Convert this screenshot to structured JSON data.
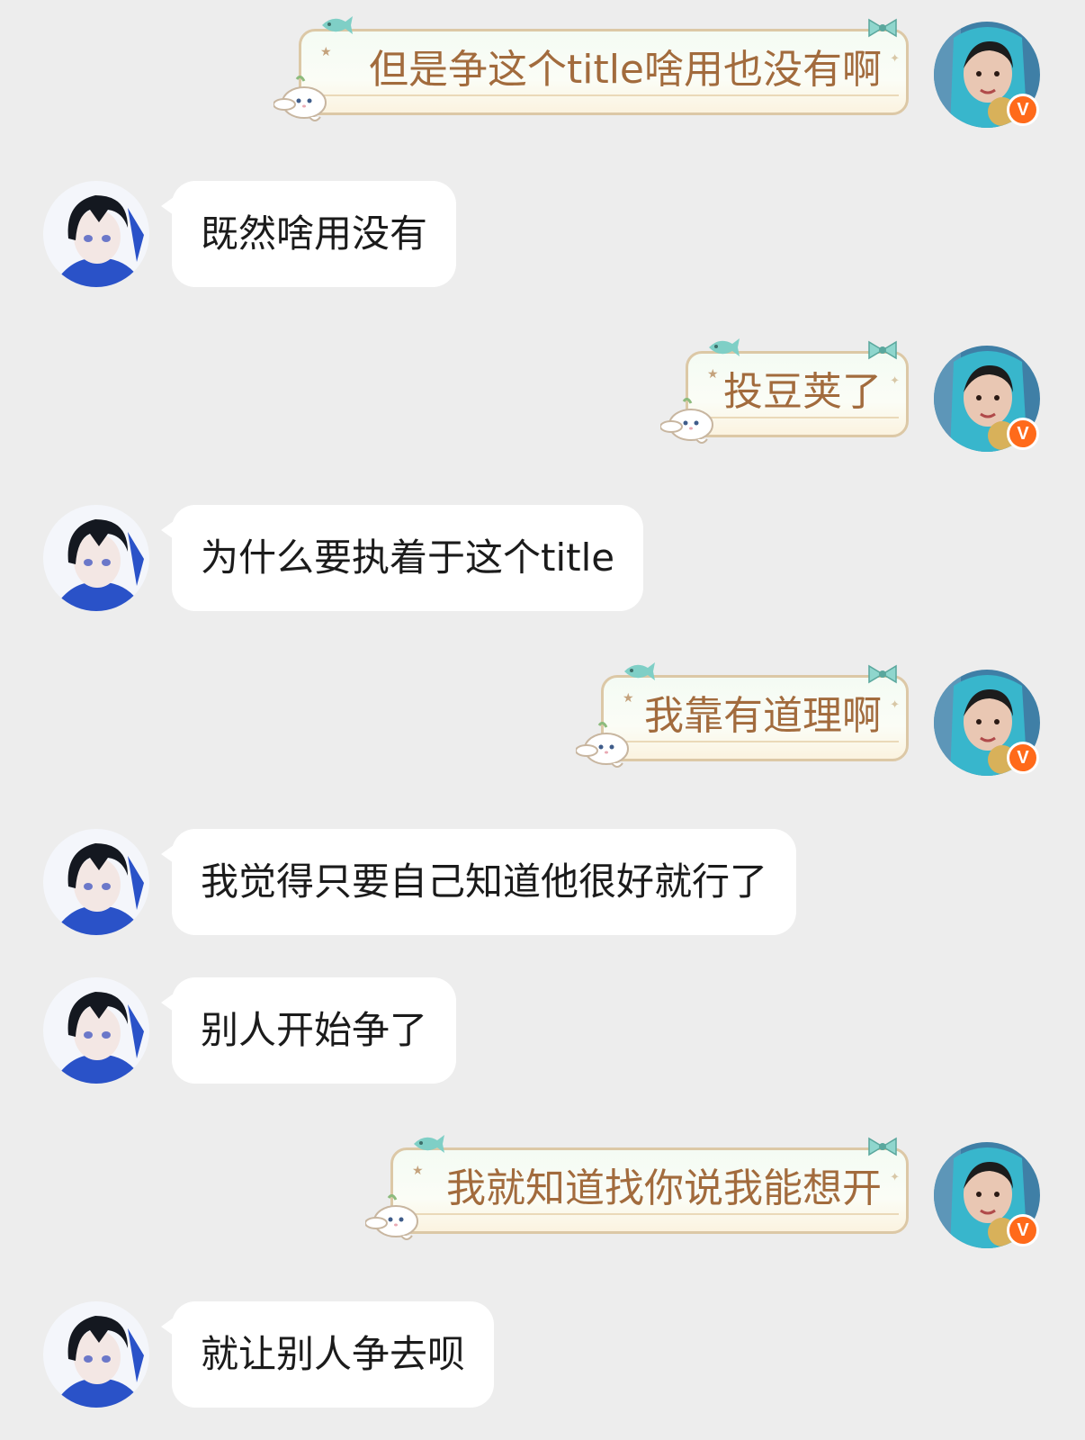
{
  "conversation": {
    "messages": [
      {
        "sender": "self",
        "text": "但是争这个title啥用也没有啊",
        "verified": "V"
      },
      {
        "sender": "other",
        "text": "既然啥用没有"
      },
      {
        "sender": "self",
        "text": "投豆荚了",
        "verified": "V"
      },
      {
        "sender": "other",
        "text": "为什么要执着于这个title"
      },
      {
        "sender": "self",
        "text": "我靠有道理啊",
        "verified": "V"
      },
      {
        "sender": "other",
        "text": "我觉得只要自己知道他很好就行了"
      },
      {
        "sender": "other",
        "text": "别人开始争了"
      },
      {
        "sender": "self",
        "text": "我就知道找你说我能想开",
        "verified": "V"
      },
      {
        "sender": "other",
        "text": "就让别人争去呗"
      }
    ]
  },
  "colors": {
    "background": "#ededed",
    "incoming_bubble": "#ffffff",
    "outgoing_text": "#a26b3d",
    "verified_badge": "#ff6a1a"
  },
  "icons": {
    "outgoing_bubble_decor": [
      "fish-icon",
      "bow-icon",
      "puppy-icon",
      "star-icon"
    ],
    "verified": "verified-badge-icon"
  }
}
